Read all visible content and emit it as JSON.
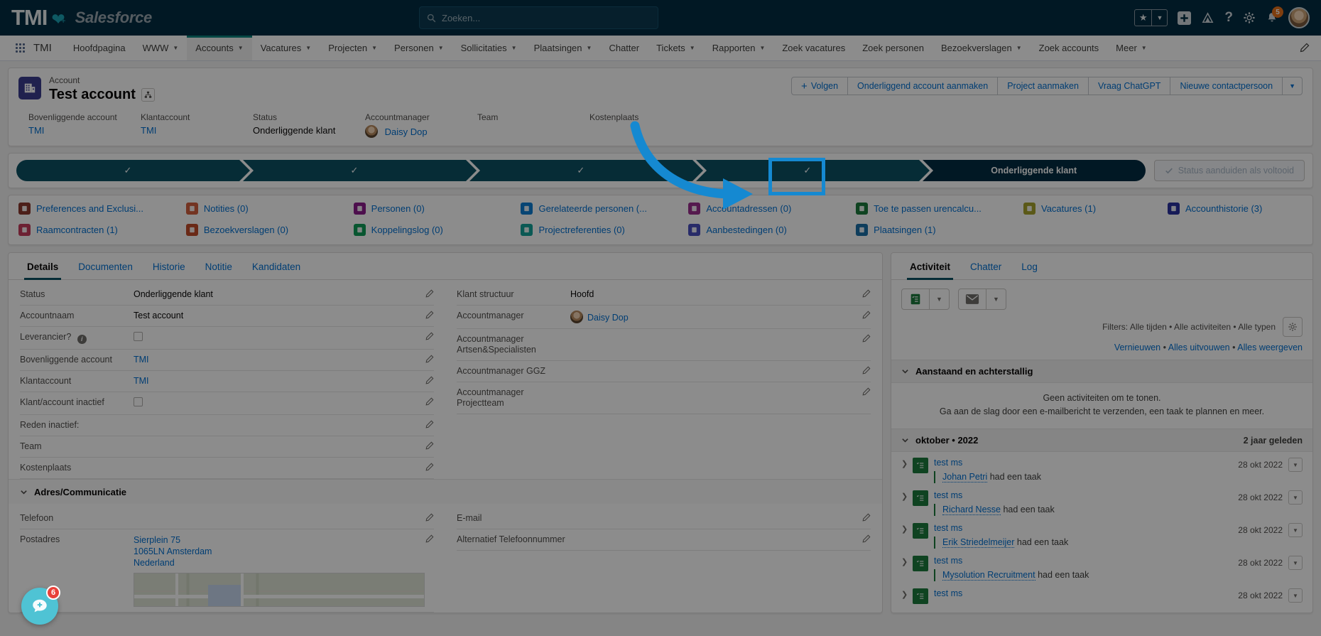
{
  "global_header": {
    "brand_tmi": "TMI",
    "brand_salesforce": "Salesforce",
    "search_placeholder": "Zoeken...",
    "notification_count": "5"
  },
  "nav": {
    "app_name": "TMI",
    "items": [
      {
        "label": "Hoofdpagina",
        "caret": false,
        "active": false
      },
      {
        "label": "WWW",
        "caret": true,
        "active": false
      },
      {
        "label": "Accounts",
        "caret": true,
        "active": true
      },
      {
        "label": "Vacatures",
        "caret": true,
        "active": false
      },
      {
        "label": "Projecten",
        "caret": true,
        "active": false
      },
      {
        "label": "Personen",
        "caret": true,
        "active": false
      },
      {
        "label": "Sollicitaties",
        "caret": true,
        "active": false
      },
      {
        "label": "Plaatsingen",
        "caret": true,
        "active": false
      },
      {
        "label": "Chatter",
        "caret": false,
        "active": false
      },
      {
        "label": "Tickets",
        "caret": true,
        "active": false
      },
      {
        "label": "Rapporten",
        "caret": true,
        "active": false
      },
      {
        "label": "Zoek vacatures",
        "caret": false,
        "active": false
      },
      {
        "label": "Zoek personen",
        "caret": false,
        "active": false
      },
      {
        "label": "Bezoekverslagen",
        "caret": true,
        "active": false
      },
      {
        "label": "Zoek accounts",
        "caret": false,
        "active": false
      },
      {
        "label": "Meer",
        "caret": true,
        "active": false
      }
    ]
  },
  "record": {
    "kicker": "Account",
    "title": "Test account",
    "buttons": [
      {
        "label": "Volgen",
        "plus": true
      },
      {
        "label": "Onderliggend account aanmaken",
        "plus": false
      },
      {
        "label": "Project aanmaken",
        "plus": false
      },
      {
        "label": "Vraag ChatGPT",
        "plus": false
      },
      {
        "label": "Nieuwe contactpersoon",
        "plus": false
      }
    ],
    "fields": [
      {
        "label": "Bovenliggende account",
        "value": "TMI",
        "link": true
      },
      {
        "label": "Klantaccount",
        "value": "TMI",
        "link": true
      },
      {
        "label": "Status",
        "value": "Onderliggende klant",
        "link": false
      },
      {
        "label": "Accountmanager",
        "value": "Daisy Dop",
        "link": true,
        "avatar": true
      },
      {
        "label": "Team",
        "value": "",
        "link": false
      },
      {
        "label": "Kostenplaats",
        "value": "",
        "link": false
      }
    ]
  },
  "path": {
    "steps": [
      {
        "label": "",
        "state": "complete"
      },
      {
        "label": "",
        "state": "complete"
      },
      {
        "label": "",
        "state": "complete"
      },
      {
        "label": "",
        "state": "complete"
      },
      {
        "label": "Onderliggende klant",
        "state": "current"
      }
    ],
    "action_button": "Status aanduiden als voltooid"
  },
  "quick_links": [
    {
      "label": "Preferences and Exclusi...",
      "color": "#8a3a2e"
    },
    {
      "label": "Notities (0)",
      "color": "#d2603e"
    },
    {
      "label": "Personen (0)",
      "color": "#8c1d8c"
    },
    {
      "label": "Gerelateerde personen (...",
      "color": "#0d7fd3"
    },
    {
      "label": "Accountadressen (0)",
      "color": "#9b2f8f"
    },
    {
      "label": "Toe te passen urencalcu...",
      "color": "#1c7a3d"
    },
    {
      "label": "Vacatures (1)",
      "color": "#a6a32c",
      "highlighted": true
    },
    {
      "label": "Accounthistorie (3)",
      "color": "#2b32a0"
    },
    {
      "label": "Raamcontracten (1)",
      "color": "#c73d5e"
    },
    {
      "label": "Bezoekverslagen (0)",
      "color": "#c14c2a"
    },
    {
      "label": "Koppelingslog (0)",
      "color": "#0f9d58"
    },
    {
      "label": "Projectreferenties (0)",
      "color": "#13a39a"
    },
    {
      "label": "Aanbestedingen (0)",
      "color": "#4a4fbf"
    },
    {
      "label": "Plaatsingen (1)",
      "color": "#1a6fa8"
    }
  ],
  "detail_tabs": [
    {
      "label": "Details",
      "active": true
    },
    {
      "label": "Documenten",
      "active": false
    },
    {
      "label": "Historie",
      "active": false
    },
    {
      "label": "Notitie",
      "active": false
    },
    {
      "label": "Kandidaten",
      "active": false
    }
  ],
  "details_left": [
    {
      "label": "Status",
      "value": "Onderliggende klant",
      "type": "text"
    },
    {
      "label": "Accountnaam",
      "value": "Test account",
      "type": "text"
    },
    {
      "label": "Leverancier?",
      "value": "",
      "type": "checkbox",
      "info": true
    },
    {
      "label": "Bovenliggende account",
      "value": "TMI",
      "type": "link"
    },
    {
      "label": "Klantaccount",
      "value": "TMI",
      "type": "link"
    },
    {
      "label": "Klant/account inactief",
      "value": "",
      "type": "checkbox"
    },
    {
      "label": "Reden inactief:",
      "value": "",
      "type": "text"
    },
    {
      "label": "Team",
      "value": "",
      "type": "text"
    },
    {
      "label": "Kostenplaats",
      "value": "",
      "type": "text"
    }
  ],
  "details_right": [
    {
      "label": "Klant structuur",
      "value": "Hoofd",
      "type": "text"
    },
    {
      "label": "Accountmanager",
      "value": "Daisy Dop",
      "type": "person"
    },
    {
      "label": "Accountmanager Artsen&Specialisten",
      "value": "",
      "type": "text"
    },
    {
      "label": "Accountmanager GGZ",
      "value": "",
      "type": "text"
    },
    {
      "label": "Accountmanager Projectteam",
      "value": "",
      "type": "text"
    }
  ],
  "address_section": {
    "title": "Adres/Communicatie",
    "rows_left": [
      {
        "label": "Telefoon",
        "value": ""
      },
      {
        "label": "Postadres",
        "value": ""
      }
    ],
    "rows_right": [
      {
        "label": "E-mail",
        "value": ""
      },
      {
        "label": "Alternatief Telefoonnummer",
        "value": ""
      }
    ],
    "address_lines": [
      "Sierplein 75",
      "1065LN Amsterdam",
      "Nederland"
    ]
  },
  "activity": {
    "tabs": [
      {
        "label": "Activiteit",
        "active": true
      },
      {
        "label": "Chatter",
        "active": false
      },
      {
        "label": "Log",
        "active": false
      }
    ],
    "filters_text": "Filters: Alle tijden • Alle activiteiten • Alle typen",
    "links": {
      "refresh": "Vernieuwen",
      "expand": "Alles uitvouwen",
      "showall": "Alles weergeven",
      "sep": " • "
    },
    "upcoming": {
      "title": "Aanstaand en achterstallig",
      "empty_line1": "Geen activiteiten om te tonen.",
      "empty_line2": "Ga aan de slag door een e-mailbericht te verzenden, een taak te plannen en meer."
    },
    "month_group": {
      "title": "oktober • 2022",
      "ago": "2 jaar geleden"
    },
    "items": [
      {
        "title": "test ms",
        "person": "Johan Petri",
        "suffix": "had een taak",
        "date": "28 okt 2022"
      },
      {
        "title": "test ms",
        "person": "Richard Nesse",
        "suffix": "had een taak",
        "date": "28 okt 2022"
      },
      {
        "title": "test ms",
        "person": "Erik Striedelmeijer",
        "suffix": "had een taak",
        "date": "28 okt 2022"
      },
      {
        "title": "test ms",
        "person": "Mysolution Recruitment",
        "suffix": "had een taak",
        "date": "28 okt 2022"
      },
      {
        "title": "test ms",
        "person": "",
        "suffix": "",
        "date": "28 okt 2022"
      }
    ]
  },
  "chat_widget": {
    "badge": "6"
  },
  "colors": {
    "accent": "#0070d2",
    "brand_dark": "#032d42",
    "path": "#0b5163",
    "annotation": "#1589d1"
  }
}
